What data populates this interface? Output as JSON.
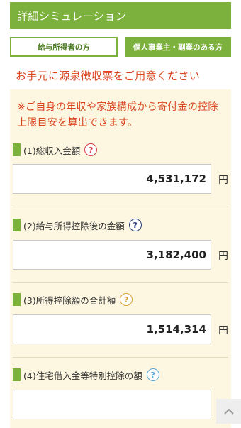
{
  "header": {
    "title": "詳細シミュレーション"
  },
  "tabs": [
    {
      "label": "給与所得者の方"
    },
    {
      "label": "個人事業主・副業のある方"
    }
  ],
  "notice": "お手元に源泉徴収票をご用意ください",
  "panel": {
    "note": "※ご自身の年収や家族構成から寄付金の控除上限目安を算出できます。",
    "fields": [
      {
        "label": "(1)総収入金額",
        "help": "?",
        "value": "4,531,172",
        "unit": "円"
      },
      {
        "label": "(2)給与所得控除後の金額",
        "help": "?",
        "value": "3,182,400",
        "unit": "円"
      },
      {
        "label": "(3)所得控除額の合計額",
        "help": "?",
        "value": "1,514,314",
        "unit": "円"
      },
      {
        "label": "(4)住宅借入金等特別控除の額",
        "help": "?",
        "value": "",
        "unit": ""
      }
    ]
  },
  "icons": {
    "help": "question-circle-icon",
    "scroll_top": "chevron-up-icon"
  },
  "colors": {
    "brand_green": "#7bb13c",
    "notice_red": "#d9451f",
    "panel_bg": "#fdf7e1"
  }
}
